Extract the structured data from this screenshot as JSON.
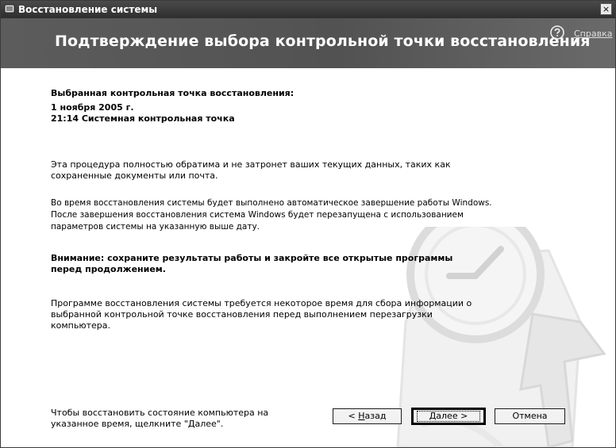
{
  "window": {
    "title": "Восстановление системы",
    "close_glyph": "×"
  },
  "header": {
    "title": "Подтверждение выбора контрольной точки восстановления",
    "help_label": "Справка",
    "help_icon": "question-icon"
  },
  "content": {
    "selected_point_label": "Выбранная контрольная точка восстановления:",
    "selected_date": "1 ноября 2005 г.",
    "selected_point": "21:14 Системная контрольная точка",
    "paragraph1": "Эта процедура полностью обратима и не затронет ваших текущих данных, таких как сохраненные документы или почта.",
    "paragraph2": "Во время восстановления системы будет выполнено автоматическое завершение работы Windows. После завершения восстановления система Windows будет перезапущена с использованием параметров системы на указанную выше дату.",
    "warning": "Внимание: сохраните результаты работы и закройте все открытые программы перед продолжением.",
    "paragraph3": "Программе восстановления системы требуется некоторое время для сбора информации о выбранной контрольной точке восстановления перед выполнением перезагрузки компьютера.",
    "bottom_hint": "Чтобы восстановить состояние компьютера на указанное время, щелкните \"Далее\"."
  },
  "buttons": {
    "back_prefix": "< ",
    "back_mnemonic": "Н",
    "back_rest": "азад",
    "next_mnemonic": "Д",
    "next_rest": "алее >",
    "cancel": "Отмена"
  }
}
